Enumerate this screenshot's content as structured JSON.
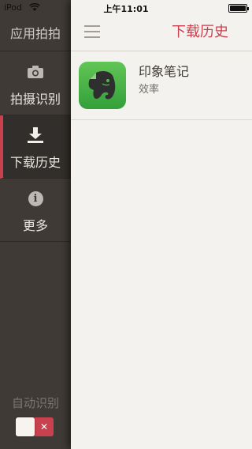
{
  "status_bar": {
    "carrier": "iPod",
    "time": "上午11:01"
  },
  "sidebar": {
    "title": "应用拍拍",
    "items": [
      {
        "label": "拍摄识别",
        "icon": "camera-icon",
        "active": false
      },
      {
        "label": "下载历史",
        "icon": "download-icon",
        "active": true
      },
      {
        "label": "更多",
        "icon": "info-icon",
        "active": false
      }
    ],
    "auto_recognize_label": "自动识别",
    "auto_recognize_toggle": {
      "state": "off",
      "symbol": "✕"
    }
  },
  "main": {
    "title": "下载历史",
    "apps": [
      {
        "name": "印象笔记",
        "category": "效率",
        "icon": "evernote-elephant-icon"
      }
    ]
  },
  "colors": {
    "accent": "#c9414e",
    "sidebar_bg": "#3f3a36",
    "main_bg": "#f4f2ee",
    "app_icon_green": "#4db848"
  }
}
